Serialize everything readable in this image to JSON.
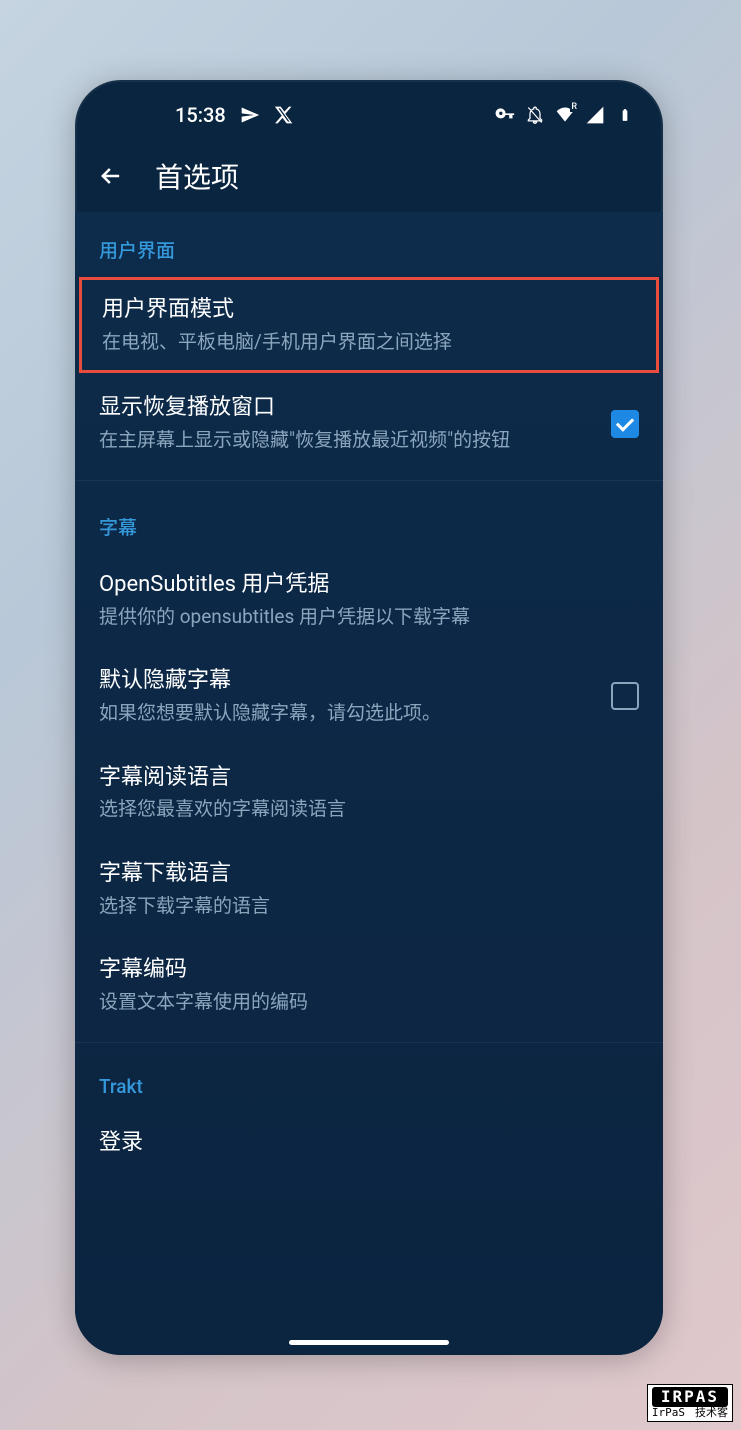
{
  "status": {
    "time": "15:38"
  },
  "appbar": {
    "title": "首选项"
  },
  "sections": {
    "ui": {
      "header": "用户界面",
      "mode": {
        "title": "用户界面模式",
        "desc": "在电视、平板电脑/手机用户界面之间选择"
      },
      "resume": {
        "title": "显示恢复播放窗口",
        "desc": "在主屏幕上显示或隐藏\"恢复播放最近视频\"的按钮"
      }
    },
    "subs": {
      "header": "字幕",
      "creds": {
        "title": "OpenSubtitles 用户凭据",
        "desc": "提供你的 opensubtitles 用户凭据以下载字幕"
      },
      "hide": {
        "title": "默认隐藏字幕",
        "desc": "如果您想要默认隐藏字幕，请勾选此项。"
      },
      "readlang": {
        "title": "字幕阅读语言",
        "desc": "选择您最喜欢的字幕阅读语言"
      },
      "dllang": {
        "title": "字幕下载语言",
        "desc": "选择下载字幕的语言"
      },
      "encoding": {
        "title": "字幕编码",
        "desc": "设置文本字幕使用的编码"
      }
    },
    "trakt": {
      "header": "Trakt",
      "login": {
        "title": "登录"
      }
    }
  },
  "watermark": {
    "big": "IRPAS",
    "s1": "IrPaS",
    "s2": "技术客"
  }
}
